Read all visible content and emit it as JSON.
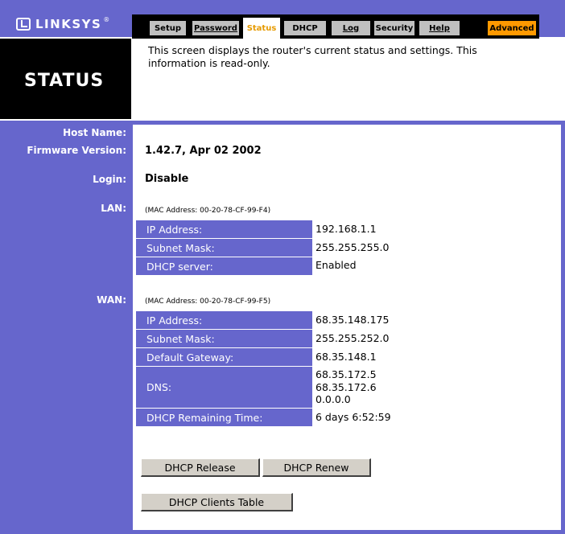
{
  "header": {
    "logo_text": "LINKSYS",
    "logo_reg": "®",
    "tabs": [
      {
        "label": "Setup"
      },
      {
        "label": "Password"
      },
      {
        "label": "Status"
      },
      {
        "label": "DHCP"
      },
      {
        "label": "Log"
      },
      {
        "label": "Security"
      },
      {
        "label": "Help"
      },
      {
        "label": "Advanced"
      }
    ],
    "active_tab": "Status"
  },
  "page": {
    "title": "STATUS",
    "description": "This screen displays the router's current status and settings. This information is read-only."
  },
  "status": {
    "host_name_label": "Host Name:",
    "host_name": "",
    "firmware_label": "Firmware Version:",
    "firmware": "1.42.7, Apr 02 2002",
    "login_label": "Login:",
    "login": "Disable"
  },
  "lan": {
    "label": "LAN:",
    "mac": "(MAC Address: 00-20-78-CF-99-F4)",
    "rows": [
      {
        "label": "IP Address:",
        "value": "192.168.1.1"
      },
      {
        "label": "Subnet Mask:",
        "value": "255.255.255.0"
      },
      {
        "label": "DHCP server:",
        "value": "Enabled"
      }
    ]
  },
  "wan": {
    "label": "WAN:",
    "mac": "(MAC Address: 00-20-78-CF-99-F5)",
    "ip_label": "IP Address:",
    "ip": "68.35.148.175",
    "mask_label": "Subnet Mask:",
    "mask": "255.255.252.0",
    "gw_label": "Default Gateway:",
    "gw": "68.35.148.1",
    "dns_label": "DNS:",
    "dns": [
      "68.35.172.5",
      "68.35.172.6",
      "0.0.0.0"
    ],
    "dhcp_time_label": "DHCP Remaining Time:",
    "dhcp_time": "6 days 6:52:59"
  },
  "buttons": {
    "release": "DHCP Release",
    "renew": "DHCP Renew",
    "clients": "DHCP Clients Table"
  },
  "colors": {
    "panel": "#6666cc",
    "active_tab_text": "#e69a00",
    "advanced_tab": "#ff9900"
  }
}
